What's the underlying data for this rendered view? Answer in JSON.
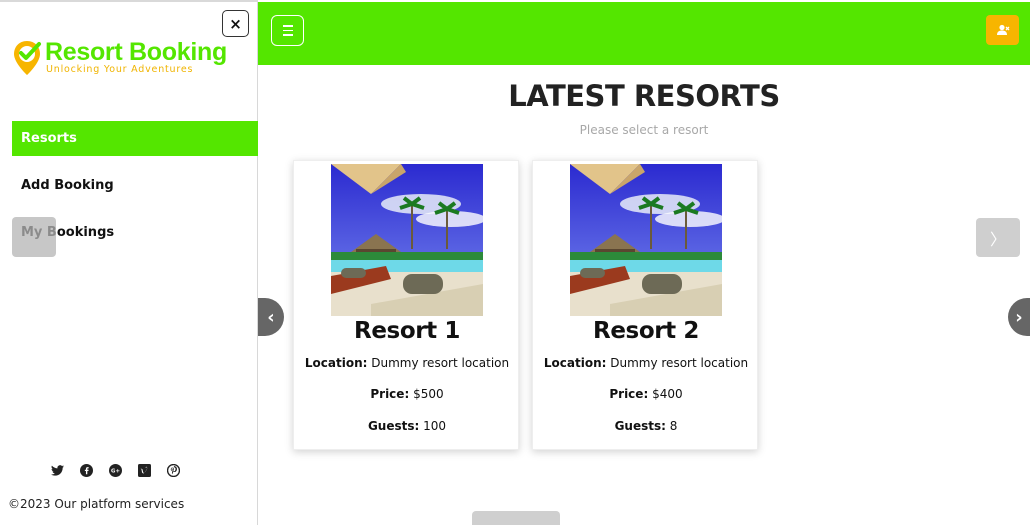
{
  "sidebar": {
    "logo_title": "Resort Booking",
    "logo_tagline": "Unlocking Your Adventures",
    "close_label": "×",
    "items": [
      {
        "label": "Resorts",
        "active": true
      },
      {
        "label": "Add Booking",
        "active": false
      },
      {
        "label": "My Bookings",
        "active": false
      }
    ],
    "socials": [
      "twitter-icon",
      "facebook-icon",
      "google-plus-icon",
      "vimeo-icon",
      "pinterest-icon"
    ],
    "copyright": "©2023 Our platform services"
  },
  "header": {
    "menu_icon": "hamburger-icon",
    "user_icon": "user-icon"
  },
  "main": {
    "title": "LATEST RESORTS",
    "subtitle": "Please select a resort",
    "location_label": "Location:",
    "price_label": "Price:",
    "guests_label": "Guests:",
    "resorts": [
      {
        "name": "Resort 1",
        "location": "Dummy resort location",
        "price": "$500",
        "guests": "100"
      },
      {
        "name": "Resort 2",
        "location": "Dummy resort location",
        "price": "$400",
        "guests": "8"
      }
    ],
    "prev_label": "‹",
    "next_label": "›",
    "next_button_label": "〉"
  },
  "colors": {
    "accent": "#54e600",
    "brand_yellow": "#f7b500"
  }
}
